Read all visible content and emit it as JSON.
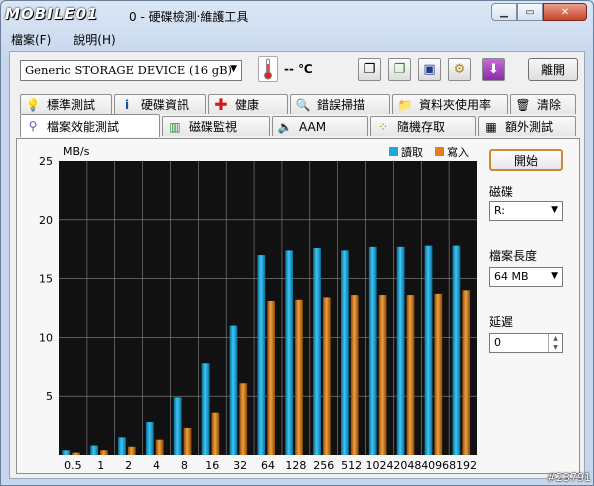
{
  "window": {
    "logo": "MOBILE01",
    "title": "0 - 硬碟檢測‧維護工具"
  },
  "menu": {
    "file": "檔案(F)",
    "help": "說明(H)"
  },
  "toolbar": {
    "device": "Generic STORAGE DEVICE  (16 gB)",
    "temperature": "-- ℃",
    "exit_label": "離開",
    "icons": [
      "copy-icon",
      "copy-text-icon",
      "save-icon",
      "settings-icon",
      "download-icon"
    ]
  },
  "tabs_row1": [
    {
      "label": "標準測試",
      "icon": "lightbulb-icon"
    },
    {
      "label": "硬碟資訊",
      "icon": "info-icon"
    },
    {
      "label": "健康",
      "icon": "health-cross-icon"
    },
    {
      "label": "錯誤掃描",
      "icon": "magnifier-icon"
    },
    {
      "label": "資料夾使用率",
      "icon": "folder-icon"
    },
    {
      "label": "清除",
      "icon": "trash-icon"
    }
  ],
  "tabs_row2": [
    {
      "label": "檔案效能測試",
      "icon": "file-benchmark-icon"
    },
    {
      "label": "磁碟監視",
      "icon": "bar-chart-icon"
    },
    {
      "label": "AAM",
      "icon": "speaker-icon"
    },
    {
      "label": "隨機存取",
      "icon": "scatter-icon"
    },
    {
      "label": "額外測試",
      "icon": "calendar-icon"
    }
  ],
  "controls": {
    "start_label": "開始",
    "disk_label": "磁碟",
    "disk_value": "R:",
    "file_length_label": "檔案長度",
    "file_length_value": "64 MB",
    "delay_label": "延遲",
    "delay_value": "0"
  },
  "chart_data": {
    "type": "bar",
    "ylabel": "MB/s",
    "ylim": [
      0,
      25
    ],
    "yticks": [
      5,
      10,
      15,
      20,
      25
    ],
    "categories": [
      "0.5",
      "1",
      "2",
      "4",
      "8",
      "16",
      "32",
      "64",
      "128",
      "256",
      "512",
      "1024",
      "2048",
      "4096",
      "8192"
    ],
    "series": [
      {
        "name": "讀取",
        "color": "#1ea7dc",
        "values": [
          0.4,
          0.8,
          1.5,
          2.8,
          4.9,
          7.8,
          11.0,
          17.0,
          17.4,
          17.6,
          17.4,
          17.7,
          17.7,
          17.8,
          17.8
        ]
      },
      {
        "name": "寫入",
        "color": "#e0801c",
        "values": [
          0.2,
          0.4,
          0.7,
          1.3,
          2.3,
          3.6,
          6.1,
          13.1,
          13.2,
          13.4,
          13.6,
          13.6,
          13.6,
          13.7,
          14.0
        ]
      }
    ],
    "legend": "top-right",
    "grid": true
  },
  "watermark": "#23791"
}
